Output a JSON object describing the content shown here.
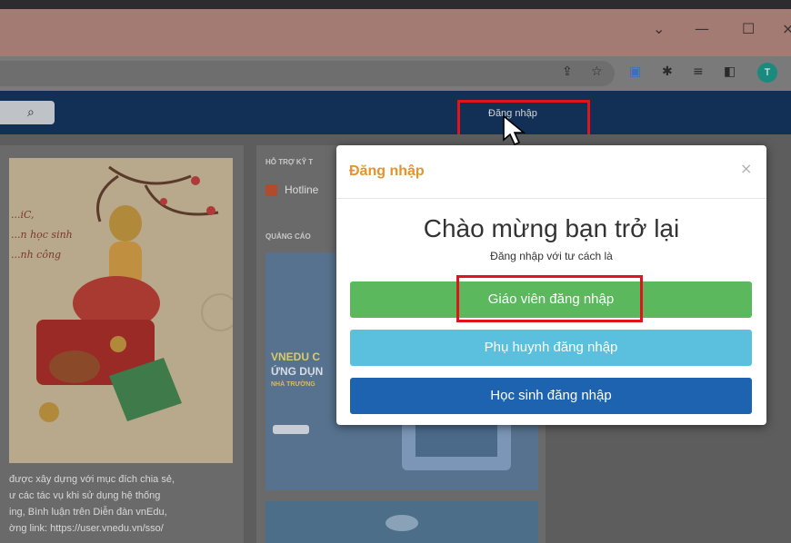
{
  "browser": {
    "window_controls": [
      "⌄",
      "—",
      "☐",
      "×"
    ],
    "toolbar_icons": [
      "share-icon",
      "star-icon",
      "translate-icon",
      "extensions-icon",
      "reading-list-icon",
      "side-panel-icon"
    ],
    "profile_initial": "T"
  },
  "site": {
    "header": {
      "search_icon": "search-icon",
      "login_link": "Đăng nhập"
    },
    "left_column": {
      "poster_script": [
        "...iC,",
        "...n học sinh",
        "...nh công"
      ],
      "intro_lines": [
        "được xây dựng với mục đích chia sẻ,",
        "ư các tác vụ khi sử dụng hệ thống",
        "ing, Bình luận trên Diễn đàn vnEdu,",
        "ờng link: https://user.vnedu.vn/sso/"
      ]
    },
    "middle_column": {
      "support_title": "HỖ TRỢ KỸ T",
      "hotline_label": "Hotline",
      "ads_title": "QUẢNG CÁO",
      "ad_text_1": "VNEDU C",
      "ad_text_2": "ỨNG DỤN",
      "ad_text_3": "NHÀ TRƯỜNG"
    }
  },
  "modal": {
    "title": "Đăng nhập",
    "close": "×",
    "welcome": "Chào mừng bạn trở lại",
    "subtitle": "Đăng nhập với tư cách là",
    "buttons": {
      "teacher": "Giáo viên đăng nhập",
      "parent": "Phụ huynh đăng nhập",
      "student": "Học sinh đăng nhập"
    },
    "colors": {
      "title": "#e8922a",
      "teacher": "#5cb85c",
      "parent": "#5bc0de",
      "student": "#1e63b0",
      "highlight": "#e0141a"
    }
  }
}
